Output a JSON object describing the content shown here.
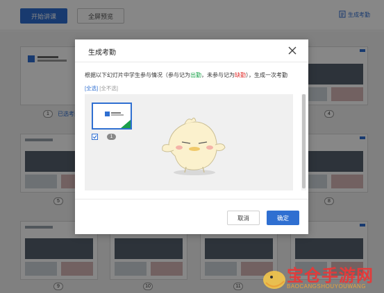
{
  "toolbar": {
    "start_label": "开始讲课",
    "fullscreen_label": "全屏预览",
    "generate_link_label": "生成考勤"
  },
  "slides": [
    {
      "number": "1",
      "attendance_tag": "已选考勤"
    },
    {
      "number": "4"
    },
    {
      "number": "5"
    },
    {
      "number": "8"
    },
    {
      "number": "9"
    },
    {
      "number": "10"
    },
    {
      "number": "11"
    }
  ],
  "dialog": {
    "title": "生成考勤",
    "desc_prefix": "根据以下幻灯片中学生参与情况（参与记为",
    "desc_present": "出勤",
    "desc_middle": "，未参与记为",
    "desc_absent": "缺勤",
    "desc_suffix": "），生成一次考勤",
    "select_all": "[全选]",
    "select_none": "[全不选]",
    "thumb_number": "1",
    "cancel_label": "取消",
    "ok_label": "确定"
  },
  "watermark": {
    "title": "宝仓手游网",
    "sub": "BAOCANGSHOUYOUWANG"
  },
  "colors": {
    "accent": "#2f6fd1",
    "present": "#1aa34a",
    "absent": "#e0312f"
  }
}
